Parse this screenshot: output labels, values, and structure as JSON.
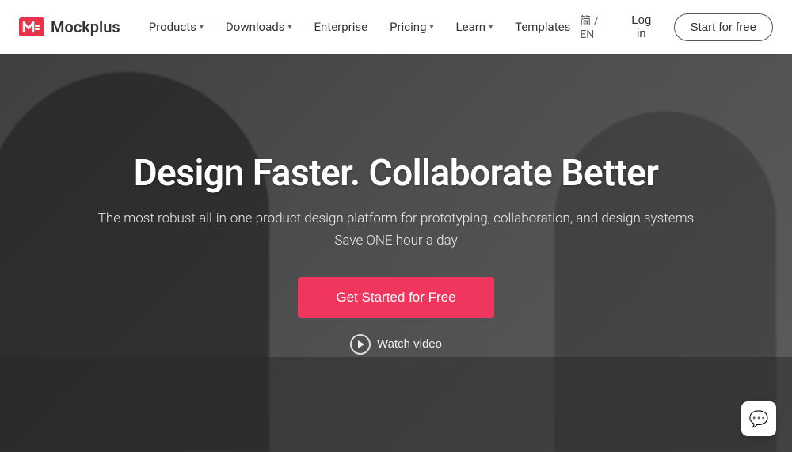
{
  "logo": {
    "name": "Mockplus",
    "icon_color": "#e8334a"
  },
  "nav": {
    "items": [
      {
        "label": "Products",
        "has_dropdown": true
      },
      {
        "label": "Downloads",
        "has_dropdown": true
      },
      {
        "label": "Enterprise",
        "has_dropdown": false
      },
      {
        "label": "Pricing",
        "has_dropdown": true
      },
      {
        "label": "Learn",
        "has_dropdown": true
      },
      {
        "label": "Templates",
        "has_dropdown": false
      }
    ],
    "lang": "简 / EN",
    "login_label": "Log in",
    "start_label": "Start for free"
  },
  "hero": {
    "title": "Design Faster. Collaborate Better",
    "subtitle": "The most robust all-in-one product design platform for prototyping, collaboration, and design systems",
    "tagline": "Save ONE hour a day",
    "cta_label": "Get Started for Free",
    "video_label": "Watch video"
  },
  "chat": {
    "icon": "💬"
  }
}
